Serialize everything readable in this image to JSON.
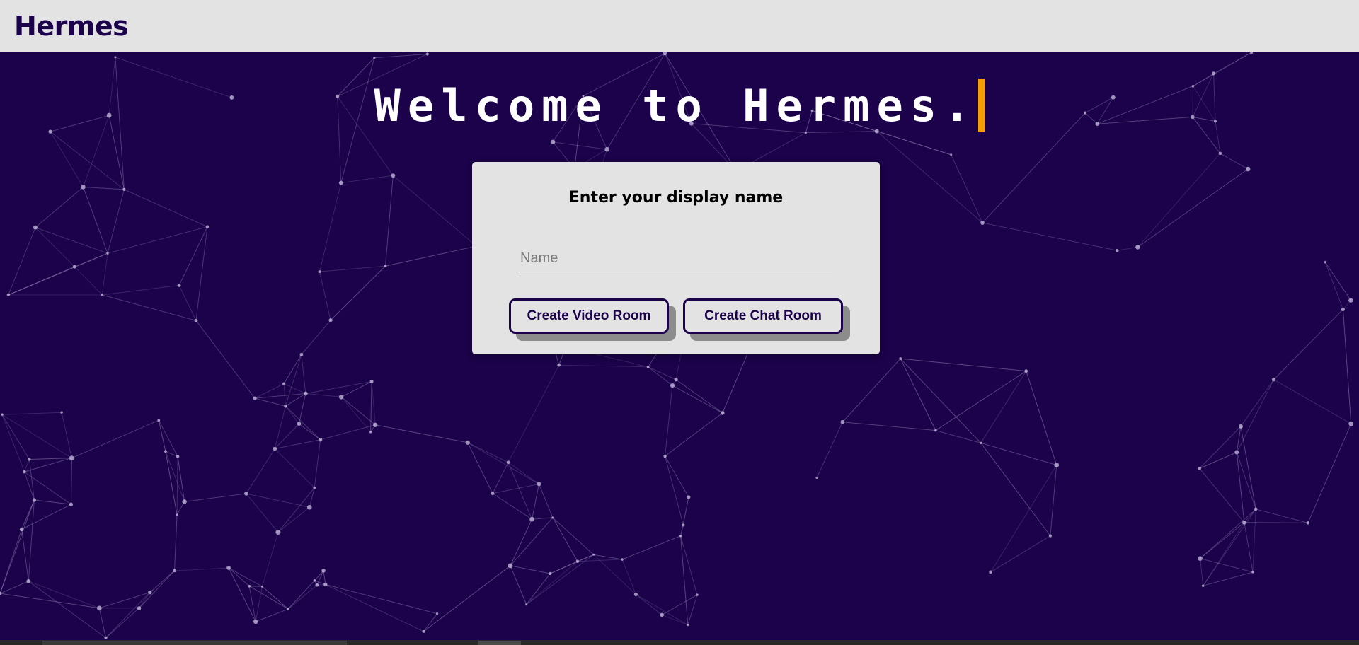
{
  "app": {
    "title": "Hermes"
  },
  "hero": {
    "welcome_text": "Welcome to Hermes."
  },
  "card": {
    "title": "Enter your display name",
    "name_input": {
      "value": "",
      "placeholder": "Name"
    },
    "buttons": {
      "video": "Create Video Room",
      "chat": "Create Chat Room"
    }
  },
  "colors": {
    "background": "#1b024a",
    "topbar": "#e3e3e3",
    "card": "#e3e3e3",
    "cursor_accent": "#f5a000",
    "button_border": "#1b024a",
    "network_lines": "#9d8fc0"
  }
}
